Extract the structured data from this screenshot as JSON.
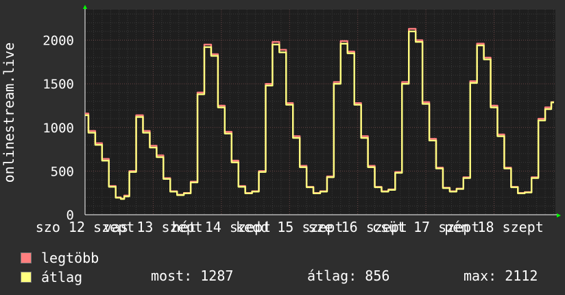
{
  "chart_data": {
    "type": "line",
    "ylabel": "onlinestream.live",
    "ylim": [
      0,
      2350
    ],
    "yticks": [
      0,
      500,
      1000,
      1500,
      2000
    ],
    "xlim": [
      0,
      6.9
    ],
    "x_ticks": [
      {
        "x": 0.0,
        "label": "szo 12 szept"
      },
      {
        "x": 1.0,
        "label": "vas 13 szept"
      },
      {
        "x": 2.0,
        "label": "hét 14 szept"
      },
      {
        "x": 3.0,
        "label": "kedd 15 szept"
      },
      {
        "x": 4.0,
        "label": "sze 16 szept"
      },
      {
        "x": 5.0,
        "label": "csüt 17 szept"
      },
      {
        "x": 6.0,
        "label": "pén 18 szept"
      }
    ],
    "grid": true,
    "series": [
      {
        "name": "legtöbb",
        "color": "#ff7f7f",
        "x": [
          0.0,
          0.1,
          0.2,
          0.3,
          0.4,
          0.5,
          0.55,
          0.6,
          0.7,
          0.8,
          0.9,
          1.0,
          1.1,
          1.2,
          1.3,
          1.4,
          1.5,
          1.6,
          1.7,
          1.8,
          1.9,
          2.0,
          2.1,
          2.2,
          2.3,
          2.4,
          2.5,
          2.6,
          2.7,
          2.8,
          2.9,
          3.0,
          3.1,
          3.2,
          3.3,
          3.4,
          3.5,
          3.6,
          3.7,
          3.8,
          3.9,
          4.0,
          4.1,
          4.2,
          4.3,
          4.4,
          4.5,
          4.6,
          4.7,
          4.8,
          4.9,
          5.0,
          5.1,
          5.2,
          5.3,
          5.4,
          5.5,
          5.6,
          5.7,
          5.8,
          5.9,
          6.0,
          6.1,
          6.2,
          6.3,
          6.4,
          6.5,
          6.6,
          6.7,
          6.8,
          6.88
        ],
        "values": [
          1160,
          960,
          820,
          640,
          330,
          200,
          185,
          220,
          500,
          1140,
          960,
          790,
          680,
          420,
          270,
          230,
          250,
          380,
          1400,
          1950,
          1840,
          1250,
          950,
          620,
          330,
          250,
          270,
          500,
          1500,
          1980,
          1890,
          1280,
          900,
          560,
          320,
          250,
          270,
          440,
          1520,
          1990,
          1870,
          1280,
          900,
          560,
          320,
          270,
          290,
          490,
          1520,
          2130,
          2000,
          1290,
          870,
          540,
          310,
          270,
          300,
          430,
          1530,
          1960,
          1800,
          1250,
          920,
          540,
          320,
          250,
          260,
          430,
          1100,
          1230,
          1290
        ]
      },
      {
        "name": "átlag",
        "color": "#ffff80",
        "x": [
          0.0,
          0.1,
          0.2,
          0.3,
          0.4,
          0.5,
          0.55,
          0.6,
          0.7,
          0.8,
          0.9,
          1.0,
          1.1,
          1.2,
          1.3,
          1.4,
          1.5,
          1.6,
          1.7,
          1.8,
          1.9,
          2.0,
          2.1,
          2.2,
          2.3,
          2.4,
          2.5,
          2.6,
          2.7,
          2.8,
          2.9,
          3.0,
          3.1,
          3.2,
          3.3,
          3.4,
          3.5,
          3.6,
          3.7,
          3.8,
          3.9,
          4.0,
          4.1,
          4.2,
          4.3,
          4.4,
          4.5,
          4.6,
          4.7,
          4.8,
          4.9,
          5.0,
          5.1,
          5.2,
          5.3,
          5.4,
          5.5,
          5.6,
          5.7,
          5.8,
          5.9,
          6.0,
          6.1,
          6.2,
          6.3,
          6.4,
          6.5,
          6.6,
          6.7,
          6.8,
          6.88
        ],
        "values": [
          1140,
          940,
          800,
          620,
          320,
          195,
          180,
          210,
          490,
          1120,
          940,
          770,
          660,
          410,
          265,
          225,
          245,
          370,
          1380,
          1920,
          1820,
          1230,
          930,
          600,
          320,
          245,
          265,
          490,
          1480,
          1950,
          1860,
          1260,
          880,
          545,
          315,
          245,
          265,
          430,
          1500,
          1960,
          1850,
          1260,
          880,
          545,
          315,
          265,
          285,
          480,
          1500,
          2100,
          1980,
          1270,
          850,
          530,
          305,
          265,
          295,
          420,
          1510,
          1940,
          1780,
          1230,
          900,
          530,
          315,
          245,
          255,
          420,
          1080,
          1210,
          1287
        ]
      }
    ]
  },
  "legend": [
    {
      "name": "legtöbb",
      "color": "#ff7f7f"
    },
    {
      "name": "átlag",
      "color": "#ffff80"
    }
  ],
  "stats": {
    "current": "most: 1287",
    "average": "átlag: 856",
    "max": "max: 2112"
  }
}
